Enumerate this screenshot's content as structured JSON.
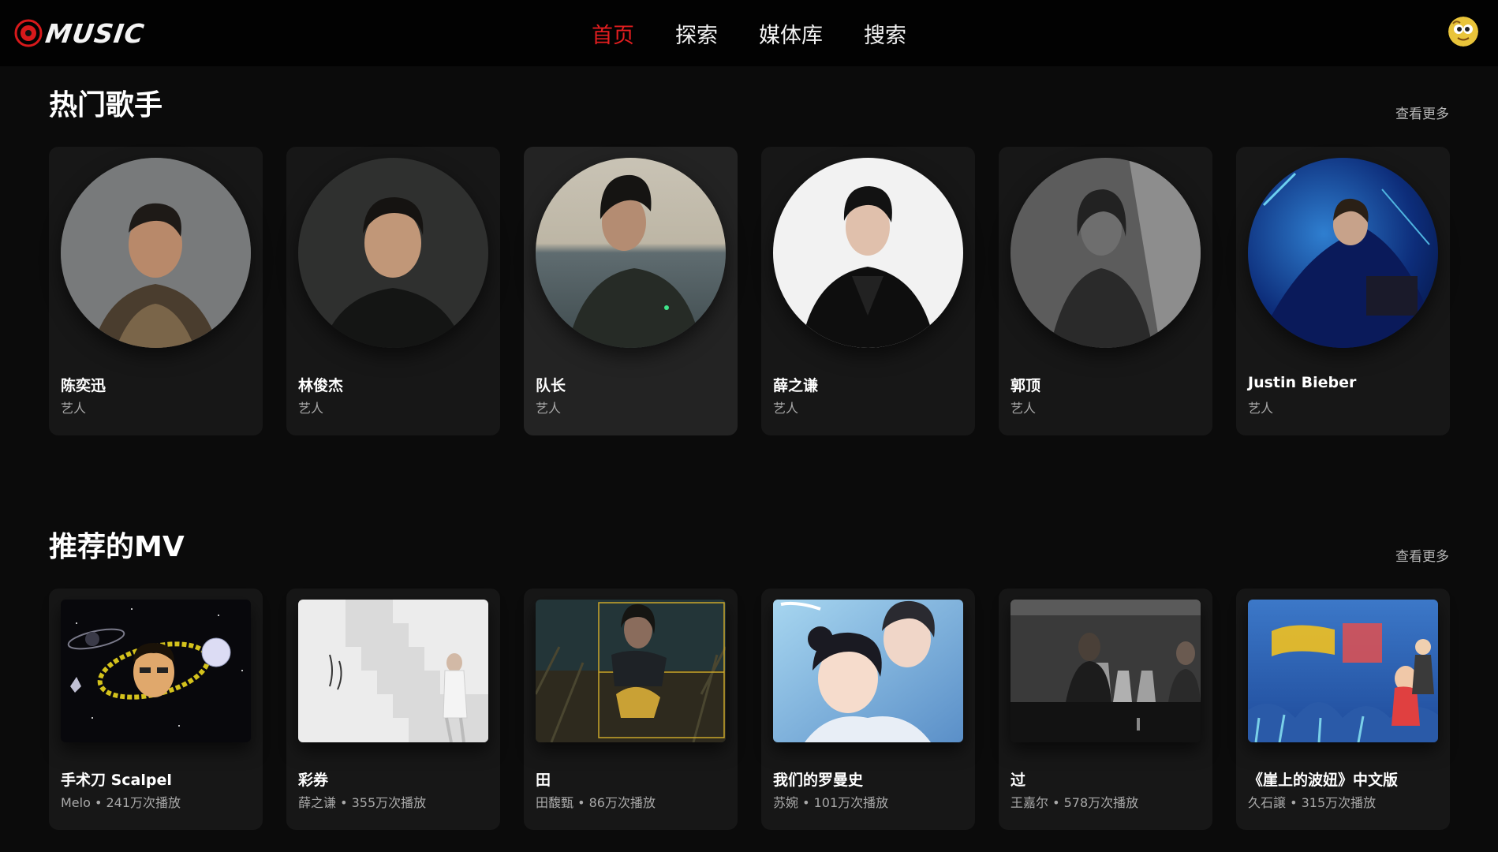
{
  "header": {
    "logo_text": "MUSIC",
    "nav": [
      {
        "label": "首页",
        "active": true
      },
      {
        "label": "探索",
        "active": false
      },
      {
        "label": "媒体库",
        "active": false
      },
      {
        "label": "搜索",
        "active": false
      }
    ],
    "avatar_icon": "emoji-avatar-icon"
  },
  "colors": {
    "accent": "#e41e20",
    "background": "#0b0b0b",
    "card": "#171717",
    "card_hover": "#232323"
  },
  "artists_section": {
    "title": "热门歌手",
    "see_more": "查看更多",
    "items": [
      {
        "name": "陈奕迅",
        "role": "艺人"
      },
      {
        "name": "林俊杰",
        "role": "艺人"
      },
      {
        "name": "队长",
        "role": "艺人"
      },
      {
        "name": "薛之谦",
        "role": "艺人"
      },
      {
        "name": "郭顶",
        "role": "艺人"
      },
      {
        "name": "Justin Bieber",
        "role": "艺人"
      }
    ]
  },
  "mv_section": {
    "title": "推荐的MV",
    "see_more": "查看更多",
    "items": [
      {
        "title": "手术刀 Scalpel",
        "meta": "Melo • 241万次播放"
      },
      {
        "title": "彩券",
        "meta": "薛之谦 • 355万次播放"
      },
      {
        "title": "田",
        "meta": "田馥甄 • 86万次播放"
      },
      {
        "title": "我们的罗曼史",
        "meta": "苏婉 • 101万次播放"
      },
      {
        "title": "过",
        "meta": "王嘉尔 • 578万次播放"
      },
      {
        "title": "《崖上的波妞》中文版",
        "meta": "久石譲 • 315万次播放"
      }
    ]
  }
}
